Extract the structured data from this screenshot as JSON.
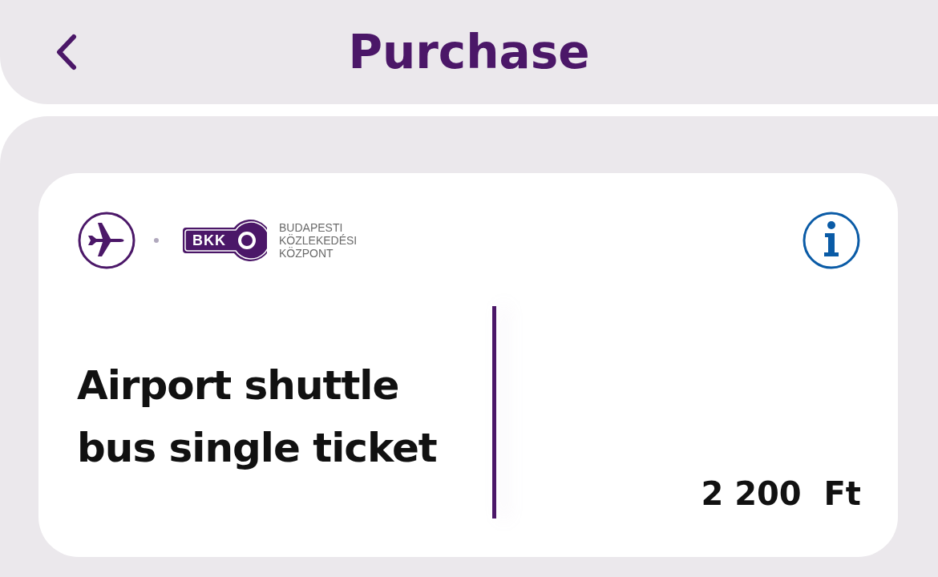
{
  "header": {
    "title": "Purchase"
  },
  "ticket": {
    "logo_text": "BKK",
    "operator_lines": [
      "BUDAPESTI",
      "KÖZLEKEDÉSI",
      "KÖZPONT"
    ],
    "name": "Airport shuttle bus single ticket",
    "price": "2 200  Ft"
  }
}
